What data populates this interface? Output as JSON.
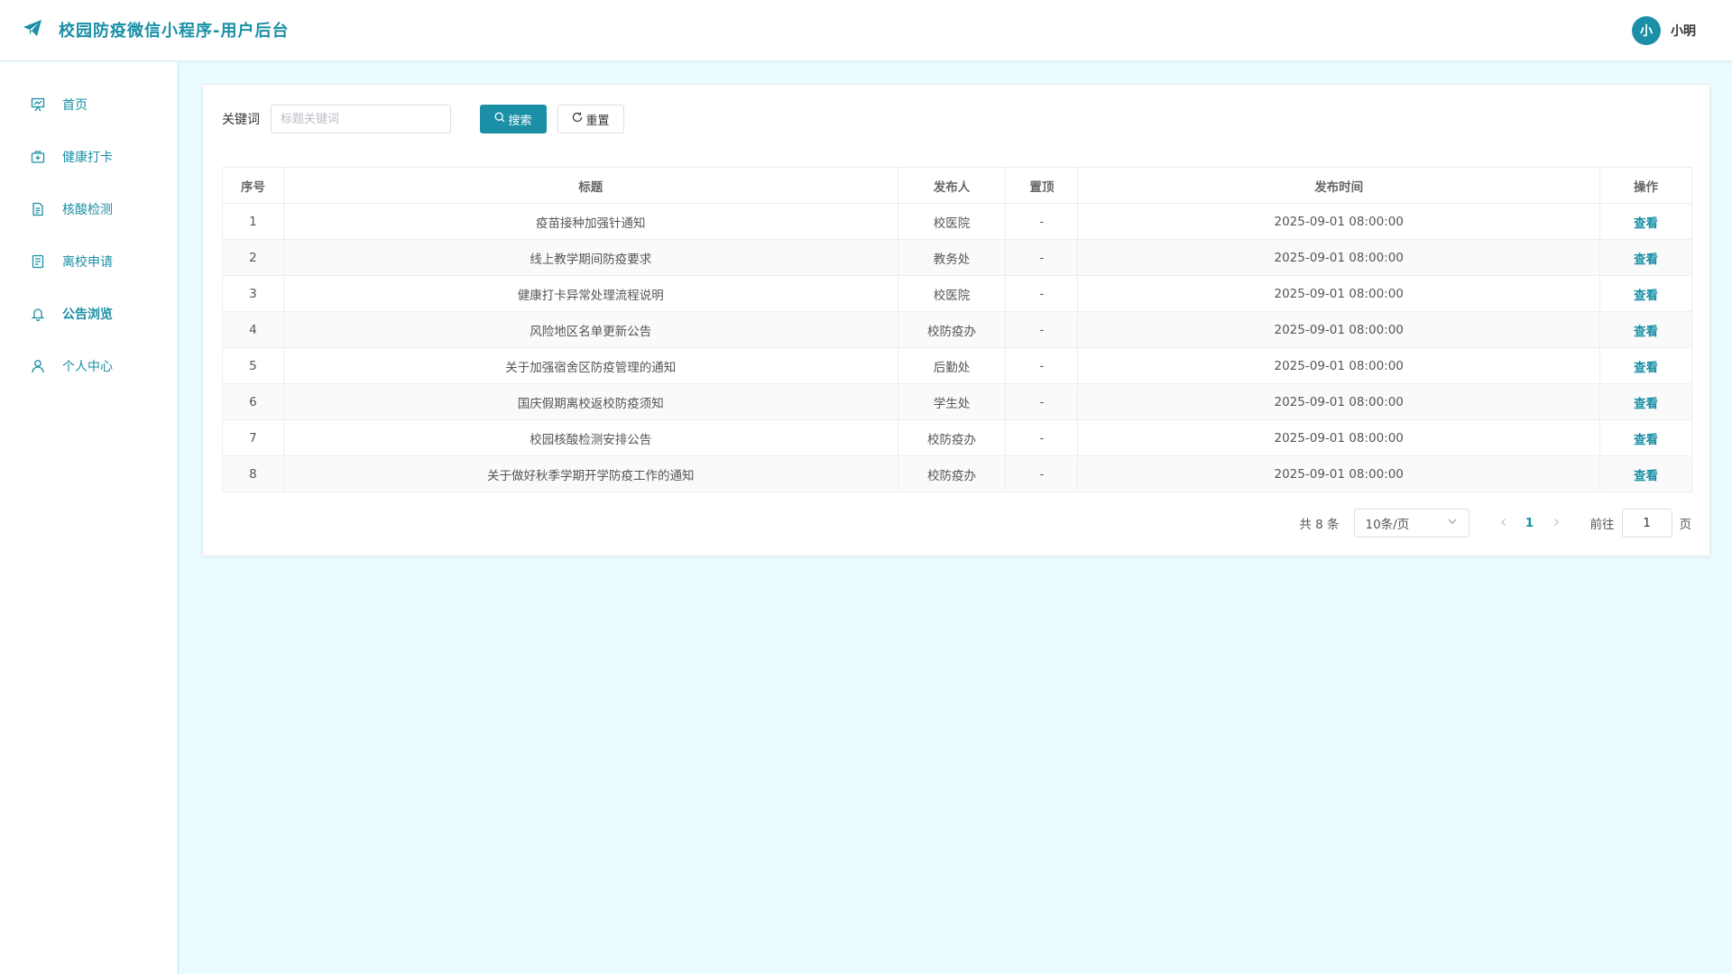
{
  "header": {
    "title": "校园防疫微信小程序-用户后台",
    "user_avatar_text": "小",
    "user_name": "小明",
    "accent_color": "#1a8fa6"
  },
  "sidebar": {
    "items": [
      {
        "label": "首页",
        "icon": "chart-board-icon"
      },
      {
        "label": "健康打卡",
        "icon": "medical-kit-icon"
      },
      {
        "label": "核酸检测",
        "icon": "document-icon"
      },
      {
        "label": "离校申请",
        "icon": "form-icon"
      },
      {
        "label": "公告浏览",
        "icon": "bell-icon"
      },
      {
        "label": "个人中心",
        "icon": "user-icon"
      }
    ]
  },
  "search": {
    "label": "关键词",
    "placeholder": "标题关键词",
    "search_button": "搜索",
    "reset_button": "重置"
  },
  "table": {
    "headers": [
      "序号",
      "标题",
      "发布人",
      "置顶",
      "发布时间",
      "操作"
    ],
    "rows": [
      {
        "no": "1",
        "title": "疫苗接种加强针通知",
        "publisher": "校医院",
        "pinned": "-",
        "time": "2025-09-01 08:00:00",
        "action": "查看"
      },
      {
        "no": "2",
        "title": "线上教学期间防疫要求",
        "publisher": "教务处",
        "pinned": "-",
        "time": "2025-09-01 08:00:00",
        "action": "查看"
      },
      {
        "no": "3",
        "title": "健康打卡异常处理流程说明",
        "publisher": "校医院",
        "pinned": "-",
        "time": "2025-09-01 08:00:00",
        "action": "查看"
      },
      {
        "no": "4",
        "title": "风险地区名单更新公告",
        "publisher": "校防疫办",
        "pinned": "-",
        "time": "2025-09-01 08:00:00",
        "action": "查看"
      },
      {
        "no": "5",
        "title": "关于加强宿舍区防疫管理的通知",
        "publisher": "后勤处",
        "pinned": "-",
        "time": "2025-09-01 08:00:00",
        "action": "查看"
      },
      {
        "no": "6",
        "title": "国庆假期离校返校防疫须知",
        "publisher": "学生处",
        "pinned": "-",
        "time": "2025-09-01 08:00:00",
        "action": "查看"
      },
      {
        "no": "7",
        "title": "校园核酸检测安排公告",
        "publisher": "校防疫办",
        "pinned": "-",
        "time": "2025-09-01 08:00:00",
        "action": "查看"
      },
      {
        "no": "8",
        "title": "关于做好秋季学期开学防疫工作的通知",
        "publisher": "校防疫办",
        "pinned": "-",
        "time": "2025-09-01 08:00:00",
        "action": "查看"
      }
    ]
  },
  "pagination": {
    "total": "共 8 条",
    "page_size": "10条/页",
    "current_page": "1",
    "goto_label": "前往",
    "goto_value": "1",
    "page_suffix": "页"
  }
}
